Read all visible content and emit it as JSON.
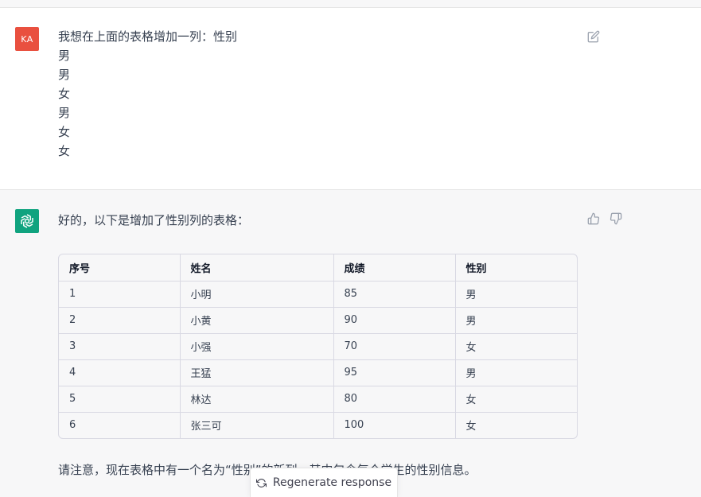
{
  "user_message": {
    "avatar_initials": "KA",
    "lines": [
      "我想在上面的表格增加一列：性别",
      "男",
      "男",
      "女",
      "男",
      "女",
      "女"
    ]
  },
  "assistant_message": {
    "intro": "好的，以下是增加了性别列的表格：",
    "table": {
      "headers": [
        "序号",
        "姓名",
        "成绩",
        "性别"
      ],
      "rows": [
        [
          "1",
          "小明",
          "85",
          "男"
        ],
        [
          "2",
          "小黄",
          "90",
          "男"
        ],
        [
          "3",
          "小强",
          "70",
          "女"
        ],
        [
          "4",
          "王猛",
          "95",
          "男"
        ],
        [
          "5",
          "林达",
          "80",
          "女"
        ],
        [
          "6",
          "张三可",
          "100",
          "女"
        ]
      ]
    },
    "note": "请注意，现在表格中有一个名为“性别”的新列，其中包含每个学生的性别信息。"
  },
  "footer": {
    "regenerate_label": "Regenerate response",
    "regenerate_icon": "refresh-icon"
  },
  "colors": {
    "user_avatar": "#e9503f",
    "assistant_avatar": "#10a37f",
    "assistant_background": "#f7f7f8"
  }
}
